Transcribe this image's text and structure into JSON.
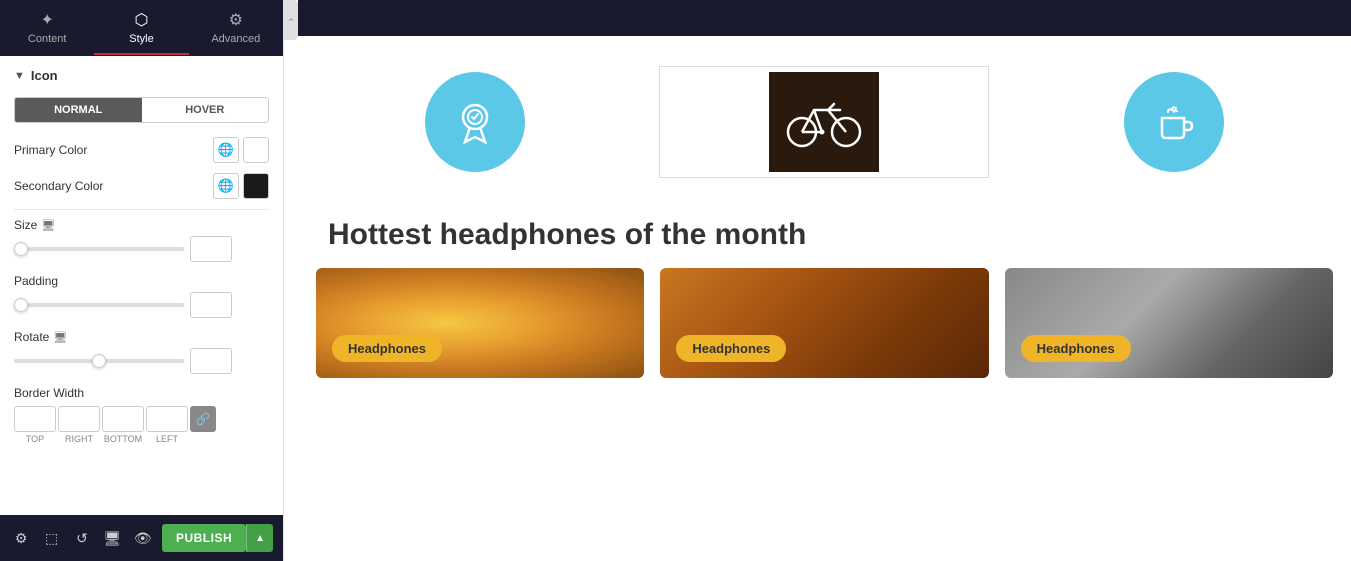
{
  "tabs": [
    {
      "id": "content",
      "label": "Content",
      "icon": "✦"
    },
    {
      "id": "style",
      "label": "Style",
      "icon": "⬡"
    },
    {
      "id": "advanced",
      "label": "Advanced",
      "icon": "⚙"
    }
  ],
  "panel": {
    "active_tab": "style",
    "section_label": "Icon",
    "normal_label": "NORMAL",
    "hover_label": "HOVER",
    "primary_color_label": "Primary Color",
    "secondary_color_label": "Secondary Color",
    "primary_color_value": "#ffffff",
    "secondary_color_value": "#1a1a1a",
    "size_label": "Size",
    "size_value": "",
    "padding_label": "Padding",
    "padding_value": "",
    "rotate_label": "Rotate",
    "rotate_value": "0",
    "border_width_label": "Border Width",
    "border_top": "",
    "border_right": "",
    "border_bottom": "",
    "border_left": "",
    "border_top_sub": "TOP",
    "border_right_sub": "RIGHT",
    "border_bottom_sub": "BOTTOM",
    "border_left_sub": "LEFT"
  },
  "toolbar": {
    "publish_label": "PUBLISH"
  },
  "main": {
    "section_title": "Hottest headphones of the month",
    "products": [
      {
        "badge": "Headphones"
      },
      {
        "badge": "Headphones"
      },
      {
        "badge": "Headphones"
      }
    ]
  }
}
